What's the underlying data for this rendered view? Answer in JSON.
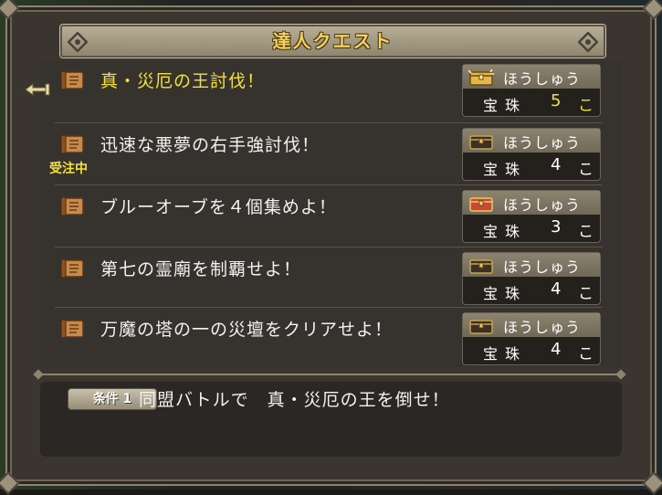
{
  "window": {
    "title": "達人クエスト"
  },
  "quests": [
    {
      "name": "真・災厄の王討伐！",
      "status": "",
      "reward_label": "ほうしゅう",
      "reward_item": "宝珠",
      "reward_count": "5",
      "reward_unit": "こ",
      "chest": "gold-chest-icon",
      "selected": true
    },
    {
      "name": "迅速な悪夢の右手強討伐！",
      "status": "受注中",
      "reward_label": "ほうしゅう",
      "reward_item": "宝珠",
      "reward_count": "4",
      "reward_unit": "こ",
      "chest": "dark-chest-icon",
      "selected": false
    },
    {
      "name": "ブルーオーブを４個集めよ！",
      "status": "",
      "reward_label": "ほうしゅう",
      "reward_item": "宝珠",
      "reward_count": "3",
      "reward_unit": "こ",
      "chest": "red-chest-icon",
      "selected": false
    },
    {
      "name": "第七の霊廟を制覇せよ！",
      "status": "",
      "reward_label": "ほうしゅう",
      "reward_item": "宝珠",
      "reward_count": "4",
      "reward_unit": "こ",
      "chest": "dark-chest-icon",
      "selected": false
    },
    {
      "name": "万魔の塔の一の災壇をクリアせよ！",
      "status": "",
      "reward_label": "ほうしゅう",
      "reward_item": "宝珠",
      "reward_count": "4",
      "reward_unit": "こ",
      "chest": "dark-chest-icon",
      "selected": false
    }
  ],
  "condition": {
    "badge": "条件 1",
    "text": "同盟バトルで　真・災厄の王を倒せ！"
  },
  "colors": {
    "highlight": "#f4e03a",
    "text": "#f2f2f2",
    "panel": "#36322d",
    "frame": "#8d8470"
  }
}
